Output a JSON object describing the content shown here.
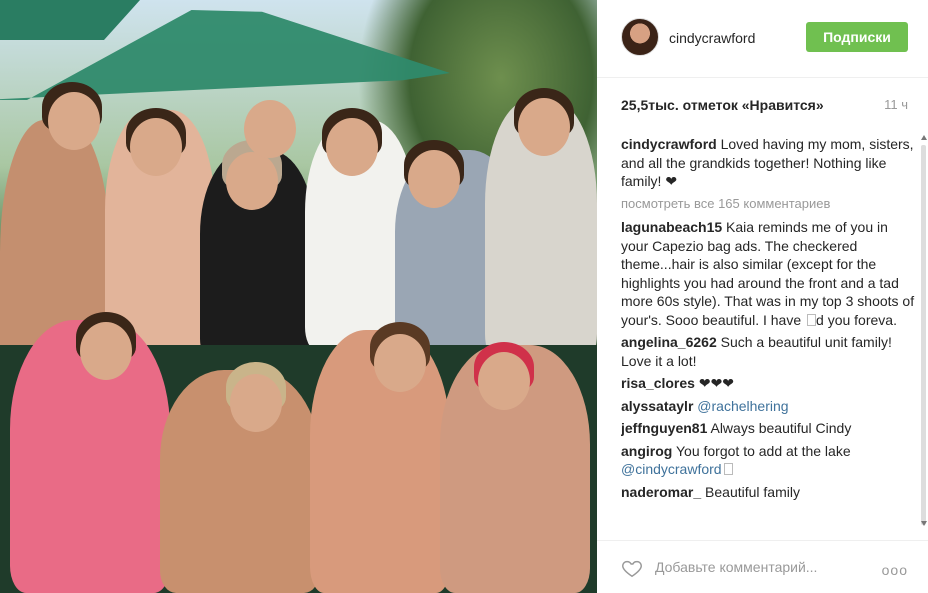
{
  "post": {
    "username": "cindycrawford",
    "follow_label": "Подписки",
    "likes_label": "25,5тыс. отметок «Нравится»",
    "time_ago": "11 ч",
    "caption": {
      "user": "cindycrawford",
      "text": "Loved having my mom, sisters, and all the grandkids together! Nothing like family! ❤"
    },
    "view_all_comments": "посмотреть все 165 комментариев",
    "comments": [
      {
        "user": "lagunabeach15",
        "text": "Kaia reminds me of you in your Capezio bag ads. The checkered theme...hair is also similar (except for the highlights you had around the front and a tad more 60s style). That was in my top 3 shoots of your's. Sooo beautiful. I have ",
        "text2": "d you foreva."
      },
      {
        "user": "angelina_6262",
        "text": "Such a beautiful unit family! Love it a lot!"
      },
      {
        "user": "risa_clores",
        "text": "❤❤❤"
      },
      {
        "user": "alyssataylr",
        "mention": "@rachelhering"
      },
      {
        "user": "jeffnguyen81",
        "text": "Always beautiful Cindy"
      },
      {
        "user": "angirog",
        "text": "You forgot to add at the lake",
        "mention": "@cindycrawford"
      },
      {
        "user": "naderomar_",
        "text": "Beautiful family"
      }
    ],
    "comment_placeholder": "Добавьте комментарий...",
    "options_glyph": "ooo"
  },
  "icons": {
    "like": "heart-icon",
    "options": "ellipsis-icon"
  },
  "colors": {
    "follow_button": "#70c050",
    "mention": "#3f729b",
    "muted": "#999999"
  }
}
